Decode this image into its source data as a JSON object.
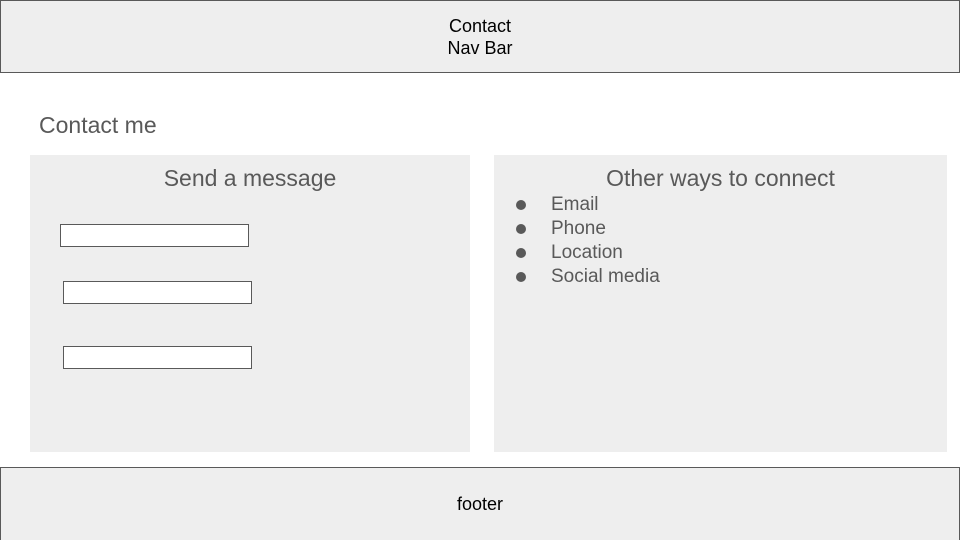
{
  "navbar": {
    "line1": "Contact",
    "line2": "Nav Bar"
  },
  "page_title": "Contact me",
  "message_panel": {
    "title": "Send a message",
    "fields": [
      {
        "value": ""
      },
      {
        "value": ""
      },
      {
        "value": ""
      }
    ]
  },
  "connect_panel": {
    "title": "Other ways to connect",
    "items": [
      "Email",
      "Phone",
      "Location",
      "Social media"
    ]
  },
  "footer": {
    "label": "footer"
  },
  "colors": {
    "panel_bg": "#eeeeee",
    "border": "#595959",
    "text_gray": "#595959",
    "text_black": "#000000",
    "page_bg": "#ffffff"
  }
}
